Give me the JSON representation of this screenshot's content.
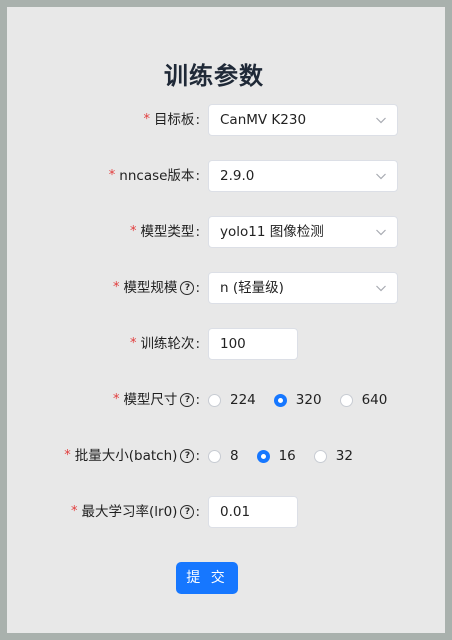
{
  "form": {
    "title": "训练参数",
    "required_mark": "*",
    "colon": ":",
    "help_glyph": "?",
    "target_board": {
      "label": "目标板",
      "value": "CanMV K230"
    },
    "nncase_version": {
      "label": "nncase版本",
      "value": "2.9.0"
    },
    "model_type": {
      "label": "模型类型",
      "value": "yolo11 图像检测"
    },
    "model_scale": {
      "label": "模型规模",
      "value": "n (轻量级)"
    },
    "epochs": {
      "label": "训练轮次",
      "value": "100"
    },
    "model_size": {
      "label": "模型尺寸",
      "options": [
        "224",
        "320",
        "640"
      ],
      "selected": "320"
    },
    "batch_size": {
      "label": "批量大小(batch)",
      "options": [
        "8",
        "16",
        "32"
      ],
      "selected": "16"
    },
    "learning_rate": {
      "label": "最大学习率(lr0)",
      "value": "0.01"
    },
    "submit_label": "提 交"
  },
  "colors": {
    "accent": "#1677ff",
    "required": "#e23b3b",
    "panel_bg": "#e8e8e8"
  }
}
